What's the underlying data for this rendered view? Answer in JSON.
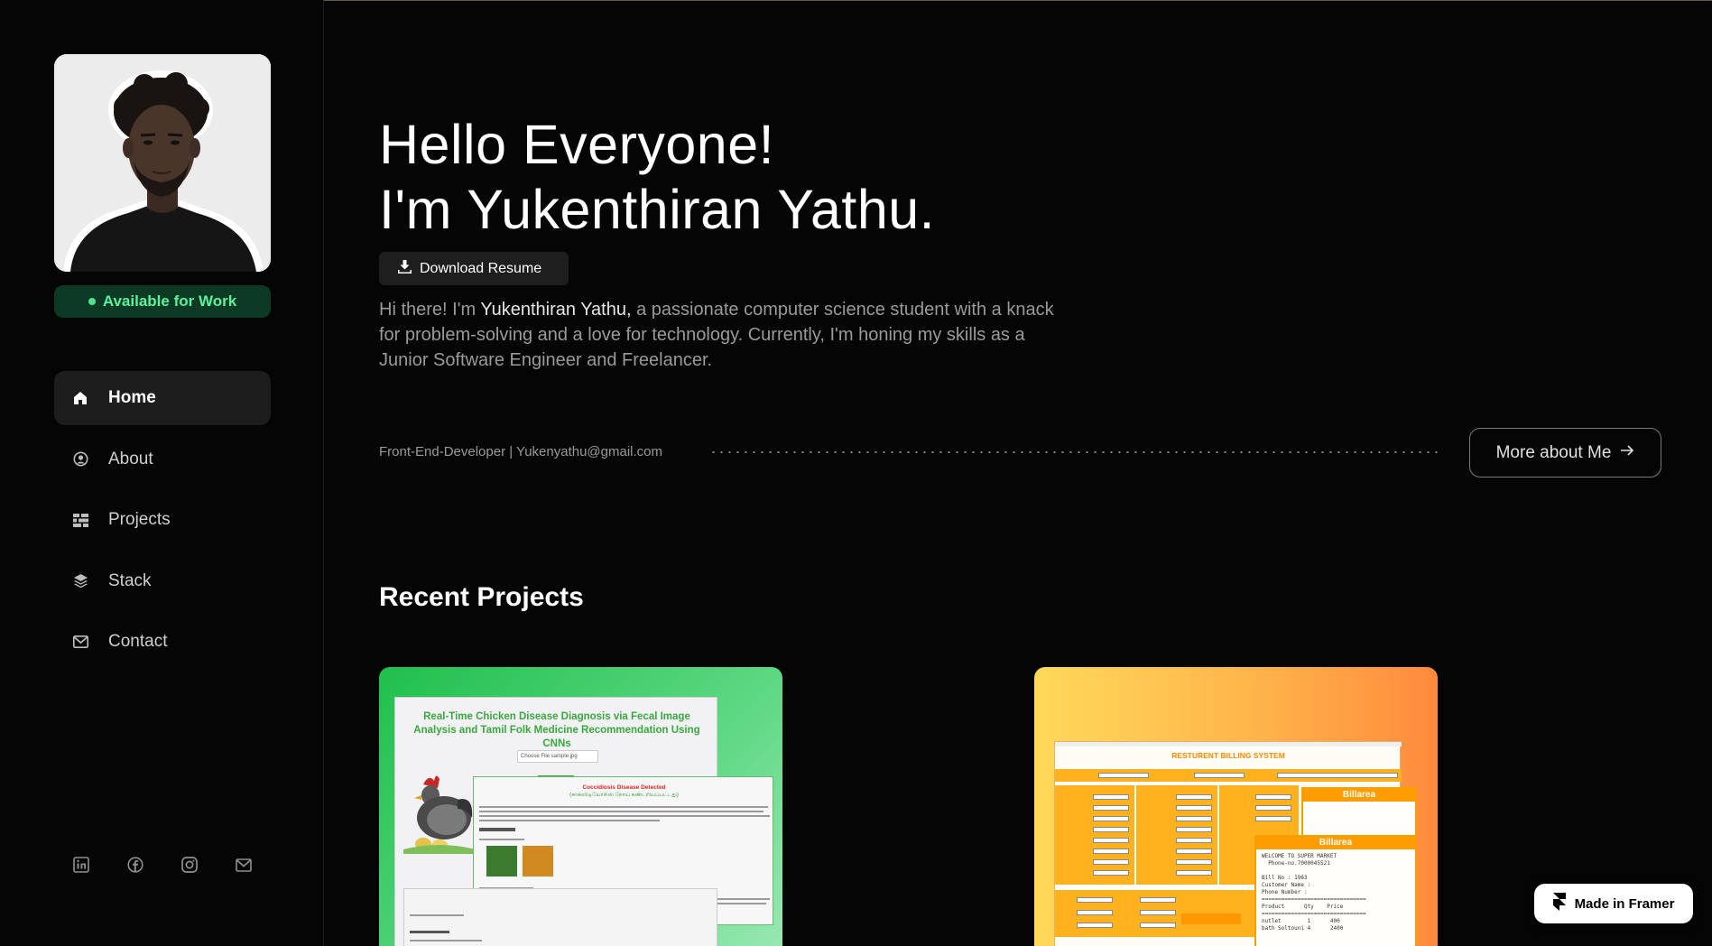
{
  "profile": {
    "status_label": "Available for Work"
  },
  "nav": {
    "items": [
      {
        "label": "Home",
        "icon": "home-icon",
        "active": true
      },
      {
        "label": "About",
        "icon": "user-circle-icon",
        "active": false
      },
      {
        "label": "Projects",
        "icon": "grid-icon",
        "active": false
      },
      {
        "label": "Stack",
        "icon": "layers-icon",
        "active": false
      },
      {
        "label": "Contact",
        "icon": "mail-icon",
        "active": false
      }
    ]
  },
  "socials": [
    "linkedin-icon",
    "facebook-icon",
    "instagram-icon",
    "email-icon"
  ],
  "hero": {
    "line1": "Hello Everyone!",
    "line2": "I'm Yukenthiran Yathu.",
    "resume_label": "Download Resume",
    "intro_before": "Hi there! I'm ",
    "intro_name": "Yukenthiran Yathu,",
    "intro_after": " a passionate computer science student with a knack for problem-solving and a love for technology. Currently, I'm honing my skills as a Junior Software Engineer and Freelancer.",
    "meta": "Front-End-Developer | Yukenyathu@gmail.com",
    "more_label": "More about Me"
  },
  "projects": {
    "title": "Recent Projects",
    "card1": {
      "title": "Real-Time Chicken Disease Diagnosis via Fecal Image Analysis and Tamil Folk Medicine Recommendation Using CNNs",
      "input": "Choose File  sample.jpg",
      "result": "Coccidiosis Disease Detected",
      "tamil": "(காக்ஸிடியோசிஸ் நோய் கண்டறியப்பட்டது)"
    },
    "card2": {
      "header": "RESTURENT BILLING SYSTEM",
      "bill_title": "Billarea",
      "receipt": "WELCOME TO SUPER MARKET\n  Phone-no.7000045521\n\nBill No : 1963\nCustomer Name :\nPhone Number :\n================================\nProduct      Qty    Price\n================================\nnutlet        1      400\nbath Soltouni 4      2400"
    }
  },
  "badge": {
    "label": "Made in Framer"
  },
  "colors": {
    "accent_green": "#5ff09e",
    "status_bg": "#0d3a25",
    "background": "#050505"
  }
}
